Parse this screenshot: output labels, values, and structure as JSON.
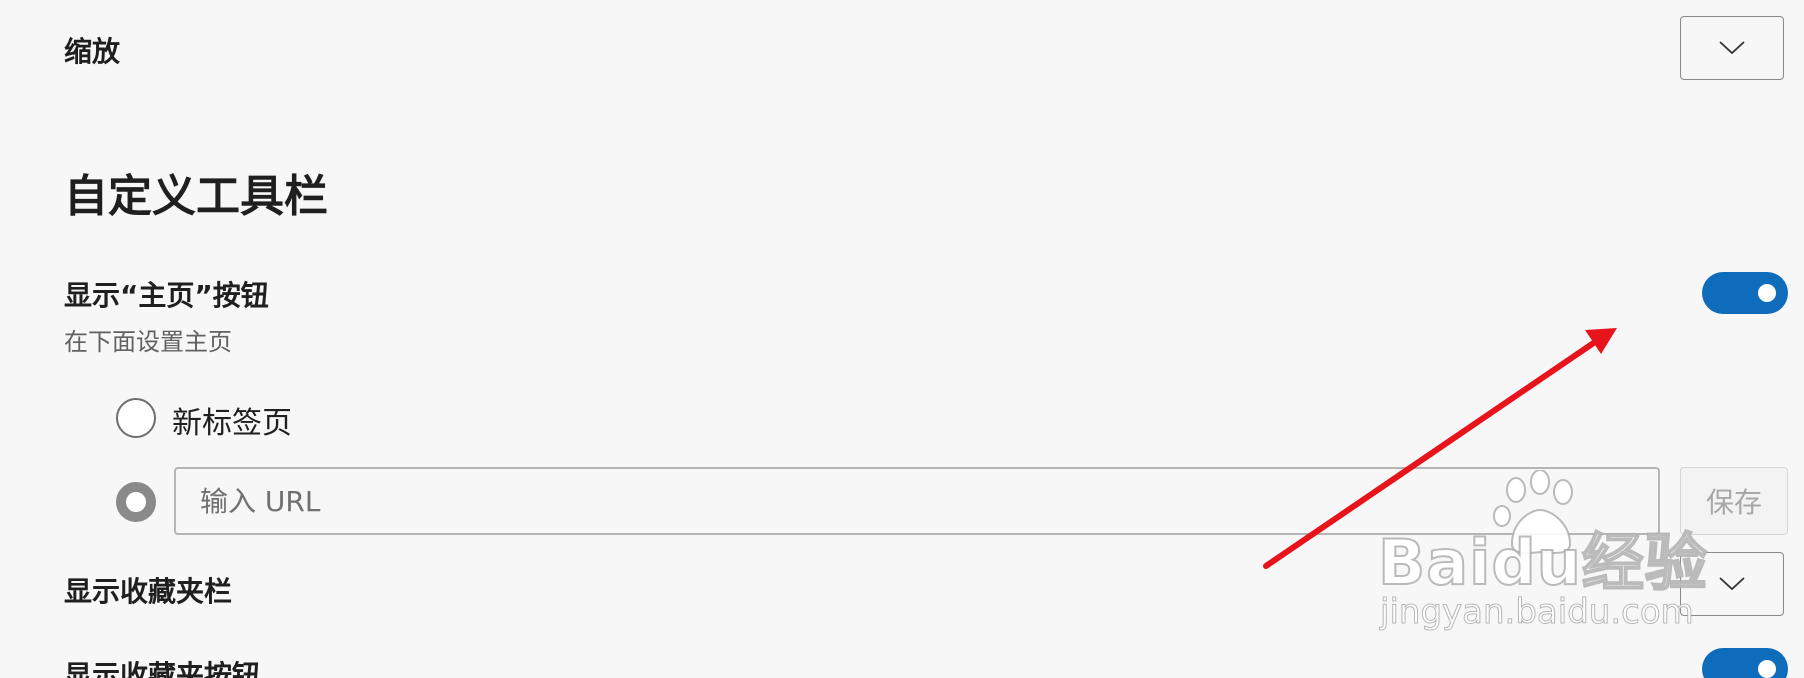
{
  "zoom": {
    "label": "缩放",
    "dropdown_icon": "chevron-down-icon"
  },
  "toolbar_section": {
    "title": "自定义工具栏"
  },
  "home_button": {
    "label": "显示“主页”按钮",
    "description": "在下面设置主页",
    "toggle_on": true,
    "options": {
      "new_tab_label": "新标签页",
      "new_tab_selected": false,
      "url_selected": true,
      "url_placeholder": "输入 URL",
      "url_value": "",
      "save_label": "保存"
    }
  },
  "favorites_bar": {
    "label": "显示收藏夹栏",
    "dropdown_icon": "chevron-down-icon"
  },
  "favorites_button": {
    "label": "显示收藏夹按钮",
    "toggle_on": true
  },
  "watermark": {
    "brand": "Baidu经验",
    "url": "jingyan.baidu.com"
  },
  "colors": {
    "accent": "#0f6cbd",
    "annotation_arrow": "#e8141b",
    "background": "#f7f7f7"
  }
}
